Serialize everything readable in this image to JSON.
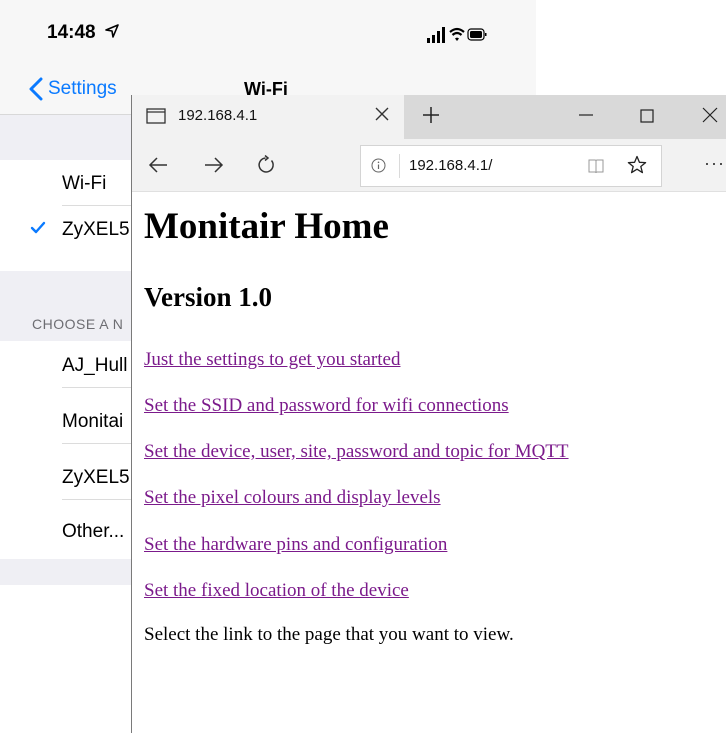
{
  "ios": {
    "status_time": "14:48",
    "nav_back_label": "Settings",
    "nav_title": "Wi-Fi",
    "wifi_label": "Wi-Fi",
    "connected_network": "ZyXEL5",
    "section_header": "CHOOSE A N",
    "networks": [
      "AJ_Hull",
      "Monitai",
      "ZyXEL5",
      "Other..."
    ],
    "accent_color": "#0a7aff"
  },
  "browser": {
    "tab_title": "192.168.4.1",
    "address": "192.168.4.1/",
    "more_label": "···"
  },
  "page": {
    "heading": "Monitair Home",
    "version": "Version 1.0",
    "links": [
      "Just the settings to get you started",
      "Set the SSID and password for wifi connections",
      "Set the device, user, site, password and topic for MQTT",
      "Set the pixel colours and display levels",
      "Set the hardware pins and configuration",
      "Set the fixed location of the device"
    ],
    "footer": "Select the link to the page that you want to view.",
    "link_color": "#7b1a8b"
  }
}
